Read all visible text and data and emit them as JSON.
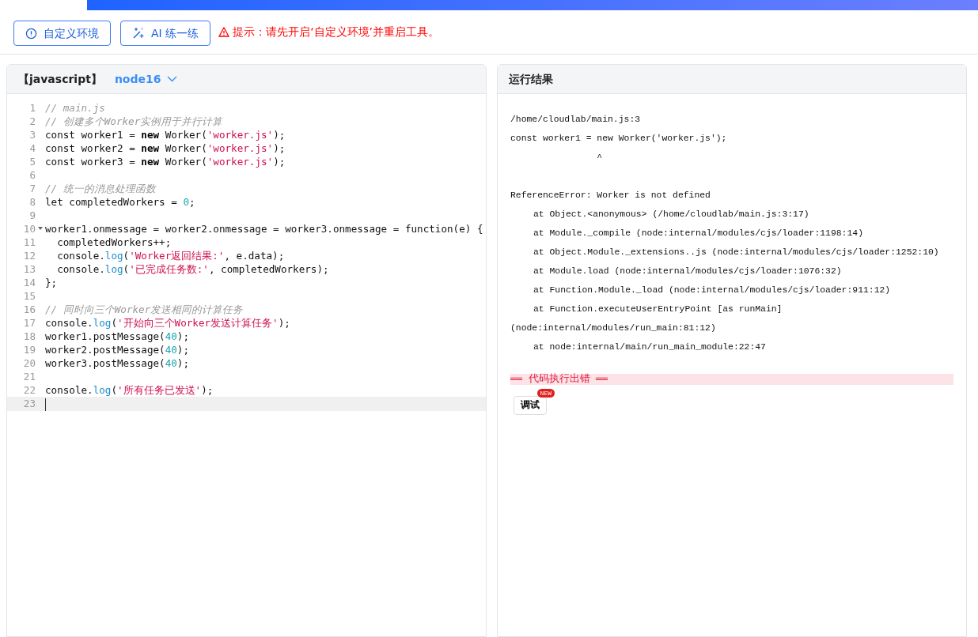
{
  "toolbar": {
    "buttons": [
      {
        "kind": "info",
        "label": "自定义环境"
      },
      {
        "kind": "ai",
        "label": "AI 练一练"
      }
    ],
    "notice": "提示：请先开启‘自定义环境’并重启工具。"
  },
  "editor": {
    "language": "【javascript】",
    "runtime": "node16",
    "lines": [
      {
        "number": "1",
        "tokens": [
          {
            "kind": "comment",
            "text": "// main.js"
          }
        ]
      },
      {
        "number": "2",
        "tokens": [
          {
            "kind": "comment",
            "text": "// 创建多个Worker实例用于并行计算"
          }
        ]
      },
      {
        "number": "3",
        "tokens": [
          {
            "kind": "plain",
            "text": "const worker1 = "
          },
          {
            "kind": "keyword",
            "text": "new"
          },
          {
            "kind": "plain",
            "text": " Worker("
          },
          {
            "kind": "string",
            "text": "'worker.js'"
          },
          {
            "kind": "plain",
            "text": ");"
          }
        ]
      },
      {
        "number": "4",
        "tokens": [
          {
            "kind": "plain",
            "text": "const worker2 = "
          },
          {
            "kind": "keyword",
            "text": "new"
          },
          {
            "kind": "plain",
            "text": " Worker("
          },
          {
            "kind": "string",
            "text": "'worker.js'"
          },
          {
            "kind": "plain",
            "text": ");"
          }
        ]
      },
      {
        "number": "5",
        "tokens": [
          {
            "kind": "plain",
            "text": "const worker3 = "
          },
          {
            "kind": "keyword",
            "text": "new"
          },
          {
            "kind": "plain",
            "text": " Worker("
          },
          {
            "kind": "string",
            "text": "'worker.js'"
          },
          {
            "kind": "plain",
            "text": ");"
          }
        ]
      },
      {
        "number": "6"
      },
      {
        "number": "7",
        "tokens": [
          {
            "kind": "comment",
            "text": "// 统一的消息处理函数"
          }
        ]
      },
      {
        "number": "8",
        "tokens": [
          {
            "kind": "plain",
            "text": "let completedWorkers = "
          },
          {
            "kind": "number",
            "text": "0"
          },
          {
            "kind": "plain",
            "text": ";"
          }
        ]
      },
      {
        "number": "9"
      },
      {
        "number": "10",
        "foldable": true,
        "tokens": [
          {
            "kind": "plain",
            "text": "worker1.onmessage = worker2.onmessage = worker3.onmessage = function(e) {"
          }
        ]
      },
      {
        "number": "11",
        "tokens": [
          {
            "kind": "plain",
            "text": "  completedWorkers++;"
          }
        ]
      },
      {
        "number": "12",
        "tokens": [
          {
            "kind": "plain",
            "text": "  console."
          },
          {
            "kind": "method",
            "text": "log"
          },
          {
            "kind": "plain",
            "text": "("
          },
          {
            "kind": "string",
            "text": "'Worker返回结果:'"
          },
          {
            "kind": "plain",
            "text": ", e.data);"
          }
        ]
      },
      {
        "number": "13",
        "tokens": [
          {
            "kind": "plain",
            "text": "  console."
          },
          {
            "kind": "method",
            "text": "log"
          },
          {
            "kind": "plain",
            "text": "("
          },
          {
            "kind": "string",
            "text": "'已完成任务数:'"
          },
          {
            "kind": "plain",
            "text": ", completedWorkers);"
          }
        ]
      },
      {
        "number": "14",
        "tokens": [
          {
            "kind": "plain",
            "text": "};"
          }
        ]
      },
      {
        "number": "15"
      },
      {
        "number": "16",
        "tokens": [
          {
            "kind": "comment",
            "text": "// 同时向三个Worker发送相同的计算任务"
          }
        ]
      },
      {
        "number": "17",
        "tokens": [
          {
            "kind": "plain",
            "text": "console."
          },
          {
            "kind": "method",
            "text": "log"
          },
          {
            "kind": "plain",
            "text": "("
          },
          {
            "kind": "string",
            "text": "'开始向三个Worker发送计算任务'"
          },
          {
            "kind": "plain",
            "text": ");"
          }
        ]
      },
      {
        "number": "18",
        "tokens": [
          {
            "kind": "plain",
            "text": "worker1.postMessage("
          },
          {
            "kind": "number",
            "text": "40"
          },
          {
            "kind": "plain",
            "text": ");"
          }
        ]
      },
      {
        "number": "19",
        "tokens": [
          {
            "kind": "plain",
            "text": "worker2.postMessage("
          },
          {
            "kind": "number",
            "text": "40"
          },
          {
            "kind": "plain",
            "text": ");"
          }
        ]
      },
      {
        "number": "20",
        "tokens": [
          {
            "kind": "plain",
            "text": "worker3.postMessage("
          },
          {
            "kind": "number",
            "text": "40"
          },
          {
            "kind": "plain",
            "text": ");"
          }
        ]
      },
      {
        "number": "21"
      },
      {
        "number": "22",
        "tokens": [
          {
            "kind": "plain",
            "text": "console."
          },
          {
            "kind": "method",
            "text": "log"
          },
          {
            "kind": "plain",
            "text": "("
          },
          {
            "kind": "string",
            "text": "'所有任务已发送'"
          },
          {
            "kind": "plain",
            "text": ");"
          }
        ]
      },
      {
        "number": "23",
        "active": true
      }
    ]
  },
  "output": {
    "title": "运行结果",
    "lines": [
      {
        "kind": "plain",
        "text": "/home/cloudlab/main.js:3"
      },
      {
        "kind": "plain",
        "text": "const worker1 = new Worker('worker.js');"
      },
      {
        "kind": "plain",
        "text": "                ^"
      },
      {
        "kind": "blank"
      },
      {
        "kind": "plain",
        "text": "ReferenceError: Worker is not defined"
      },
      {
        "kind": "frame",
        "text": "at Object.<anonymous> (/home/cloudlab/main.js:3:17)"
      },
      {
        "kind": "frame",
        "text": "at Module._compile (node:internal/modules/cjs/loader:1198:14)"
      },
      {
        "kind": "frame",
        "text": "at Object.Module._extensions..js (node:internal/modules/cjs/loader:1252:10)"
      },
      {
        "kind": "frame",
        "text": "at Module.load (node:internal/modules/cjs/loader:1076:32)"
      },
      {
        "kind": "frame",
        "text": "at Function.Module._load (node:internal/modules/cjs/loader:911:12)"
      },
      {
        "kind": "frame",
        "text": "at Function.executeUserEntryPoint [as runMain]"
      },
      {
        "kind": "plain",
        "text": "(node:internal/modules/run_main:81:12)"
      },
      {
        "kind": "frame",
        "text": "at node:internal/main/run_main_module:22:47"
      }
    ],
    "error_banner": "══ 代码执行出错 ══",
    "debug_button": "调试",
    "debug_badge": "NEW"
  }
}
